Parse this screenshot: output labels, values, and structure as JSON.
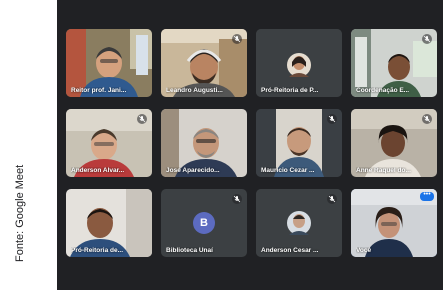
{
  "caption": "Fonte: Google Meet",
  "accent_color": "#8ab4f8",
  "participants": [
    {
      "name": "Reitor prof. Jani...",
      "muted": false,
      "type": "video"
    },
    {
      "name": "Leandro Augusti...",
      "muted": true,
      "type": "video"
    },
    {
      "name": "Pró-Reitoria de P...",
      "muted": false,
      "type": "photo"
    },
    {
      "name": "Coordenação E...",
      "muted": true,
      "type": "video"
    },
    {
      "name": "Anderson Alvar...",
      "muted": true,
      "type": "video"
    },
    {
      "name": "Jose Aparecido...",
      "muted": false,
      "type": "video"
    },
    {
      "name": "Mauricio Cezar ...",
      "muted": true,
      "type": "video"
    },
    {
      "name": "Anne Raquel do...",
      "muted": true,
      "type": "video"
    },
    {
      "name": "Pró-Reitoria de...",
      "muted": false,
      "type": "video"
    },
    {
      "name": "Biblioteca Unaí",
      "muted": true,
      "type": "initial",
      "initial": "B"
    },
    {
      "name": "Anderson Cesar ...",
      "muted": true,
      "type": "photo"
    },
    {
      "name": "Você",
      "muted": false,
      "type": "video",
      "self": true
    }
  ]
}
